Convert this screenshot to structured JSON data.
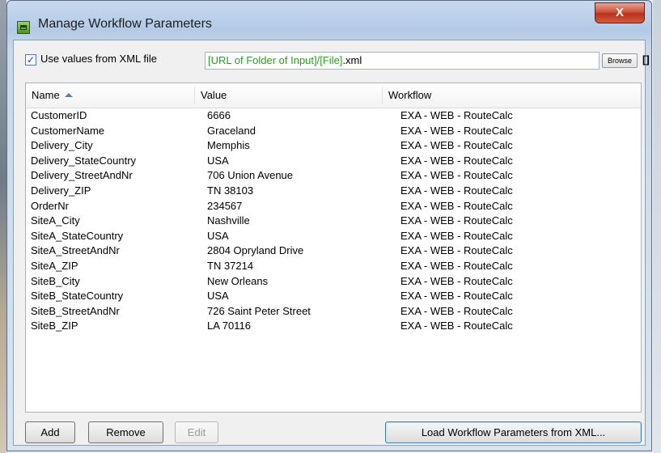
{
  "window": {
    "title": "Manage Workflow Parameters",
    "close_label": "X"
  },
  "xml": {
    "checked": true,
    "label": "Use values from XML file",
    "path_green": "[URL of Folder of Input]/[File]",
    "path_suffix": ".xml",
    "browse_label": "Browse",
    "extra_label": "[]"
  },
  "table": {
    "headers": [
      "Name",
      "Value",
      "Workflow"
    ],
    "sort_column": "Name",
    "rows": [
      [
        "CustomerID",
        "6666",
        "EXA - WEB - RouteCalc"
      ],
      [
        "CustomerName",
        "Graceland",
        "EXA - WEB - RouteCalc"
      ],
      [
        "Delivery_City",
        "Memphis",
        "EXA - WEB - RouteCalc"
      ],
      [
        "Delivery_StateCountry",
        "USA",
        "EXA - WEB - RouteCalc"
      ],
      [
        "Delivery_StreetAndNr",
        "706 Union Avenue",
        "EXA - WEB - RouteCalc"
      ],
      [
        "Delivery_ZIP",
        "TN 38103",
        "EXA - WEB - RouteCalc"
      ],
      [
        "OrderNr",
        "234567",
        "EXA - WEB - RouteCalc"
      ],
      [
        "SiteA_City",
        "Nashville",
        "EXA - WEB - RouteCalc"
      ],
      [
        "SiteA_StateCountry",
        "USA",
        "EXA - WEB - RouteCalc"
      ],
      [
        "SiteA_StreetAndNr",
        "2804 Opryland Drive",
        "EXA - WEB - RouteCalc"
      ],
      [
        "SiteA_ZIP",
        "TN 37214",
        "EXA - WEB - RouteCalc"
      ],
      [
        "SiteB_City",
        "New Orleans",
        "EXA - WEB - RouteCalc"
      ],
      [
        "SiteB_StateCountry",
        "USA",
        "EXA - WEB - RouteCalc"
      ],
      [
        "SiteB_StreetAndNr",
        "726 Saint Peter Street",
        "EXA - WEB - RouteCalc"
      ],
      [
        "SiteB_ZIP",
        "LA 70116",
        "EXA - WEB - RouteCalc"
      ]
    ]
  },
  "buttons": {
    "add": "Add",
    "remove": "Remove",
    "edit": "Edit",
    "load": "Load Workflow Parameters from XML..."
  },
  "icons": {
    "app": "workflow-app-icon",
    "check": "checkmark-icon",
    "sort": "sort-ascending-icon"
  }
}
